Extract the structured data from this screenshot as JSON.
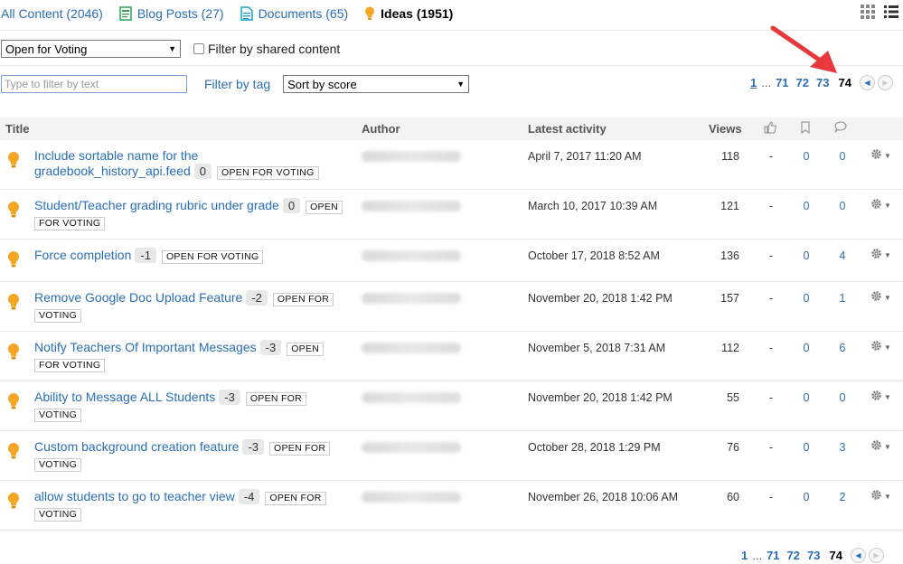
{
  "tabs": [
    {
      "label": "All Content (2046)",
      "icon": "none"
    },
    {
      "label": "Blog Posts (27)",
      "icon": "blog-post-icon"
    },
    {
      "label": "Documents (65)",
      "icon": "document-icon"
    },
    {
      "label": "Ideas (1951)",
      "icon": "lightbulb-icon"
    }
  ],
  "colors": {
    "accent": "#2a6eb8",
    "bulb": "#f5a623",
    "arrow": "#e8383b"
  },
  "filters": {
    "status_select": "Open for Voting",
    "shared_label": "Filter by shared content",
    "text_placeholder": "Type to filter by text",
    "tag_label": "Filter by tag",
    "sort_select": "Sort by score"
  },
  "pager": {
    "first": "1",
    "dots": "...",
    "p1": "71",
    "p2": "72",
    "p3": "73",
    "current": "74"
  },
  "columns": {
    "title": "Title",
    "author": "Author",
    "activity": "Latest activity",
    "views": "Views"
  },
  "rows": [
    {
      "title_a": "Include sortable name for the",
      "title_b": "gradebook_history_api.feed",
      "score": "0",
      "status": "OPEN FOR VOTING",
      "date": "April 7, 2017 11:20 AM",
      "views": "118",
      "likes": "-",
      "bookmarks": "0",
      "comments": "0"
    },
    {
      "title_a": "Student/Teacher grading rubric under grade",
      "score": "0",
      "status_a": "OPEN",
      "status_b": "FOR VOTING",
      "date": "March 10, 2017 10:39 AM",
      "views": "121",
      "likes": "-",
      "bookmarks": "0",
      "comments": "0"
    },
    {
      "title_a": "Force completion",
      "score": "-1",
      "status": "OPEN FOR VOTING",
      "date": "October 17, 2018 8:52 AM",
      "views": "136",
      "likes": "-",
      "bookmarks": "0",
      "comments": "4"
    },
    {
      "title_a": "Remove Google Doc Upload Feature",
      "score": "-2",
      "status_a": "OPEN FOR",
      "status_b": "VOTING",
      "date": "November 20, 2018 1:42 PM",
      "views": "157",
      "likes": "-",
      "bookmarks": "0",
      "comments": "1"
    },
    {
      "title_a": "Notify Teachers Of Important Messages",
      "score": "-3",
      "status_a": "OPEN",
      "status_b": "FOR VOTING",
      "date": "November 5, 2018 7:31 AM",
      "views": "112",
      "likes": "-",
      "bookmarks": "0",
      "comments": "6"
    },
    {
      "title_a": "Ability to Message ALL Students",
      "score": "-3",
      "status_a": "OPEN FOR",
      "status_b": "VOTING",
      "date": "November 20, 2018 1:42 PM",
      "views": "55",
      "likes": "-",
      "bookmarks": "0",
      "comments": "0"
    },
    {
      "title_a": "Custom background creation feature",
      "score": "-3",
      "status_a": "OPEN FOR",
      "status_b": "VOTING",
      "date": "October 28, 2018 1:29 PM",
      "views": "76",
      "likes": "-",
      "bookmarks": "0",
      "comments": "3"
    },
    {
      "title_a": "allow students to go to teacher view",
      "score": "-4",
      "status_a": "OPEN FOR",
      "status_b": "VOTING",
      "date": "November 26, 2018 10:06 AM",
      "views": "60",
      "likes": "-",
      "bookmarks": "0",
      "comments": "2"
    }
  ]
}
